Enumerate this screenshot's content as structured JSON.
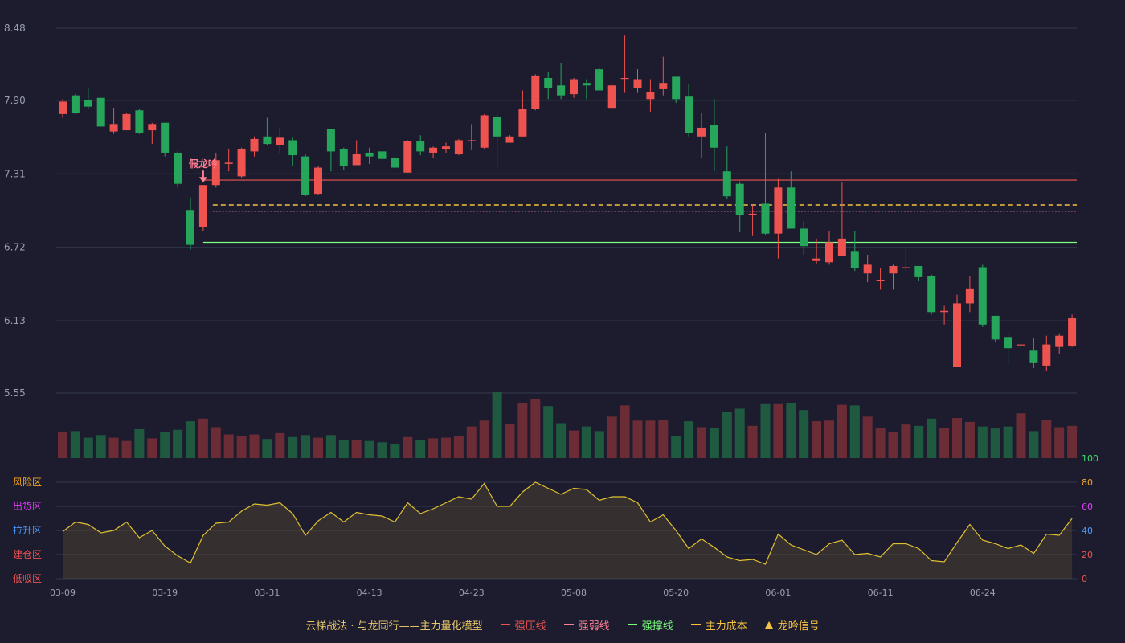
{
  "colors": {
    "up": "#ef5350",
    "down": "#26a65b",
    "grid": "#343a4e",
    "strong_pressure": "#ef5350",
    "strong_weak": "#ff7f94",
    "support": "#7cff7c",
    "cost": "#f5c242",
    "oscillator": "#e0c030"
  },
  "legend": {
    "title": "云梯战法 · 与龙同行——主力量化模型",
    "items": [
      {
        "label": "强压线",
        "color": "#ef5350",
        "style": "solid"
      },
      {
        "label": "强弱线",
        "color": "#ff7f94",
        "style": "dashed"
      },
      {
        "label": "强撑线",
        "color": "#7cff7c",
        "style": "solid"
      },
      {
        "label": "主力成本",
        "color": "#f5c242",
        "style": "dashed"
      },
      {
        "label": "龙吟信号",
        "color": "#f5c242",
        "style": "triangle"
      }
    ]
  },
  "chart_data": {
    "type": "candlestick",
    "price_axis": {
      "ticks": [
        "8.48",
        "7.90",
        "7.31",
        "6.72",
        "6.13",
        "5.55"
      ],
      "ylim": [
        5.55,
        8.48
      ]
    },
    "x_ticks": [
      {
        "index": 0,
        "label": "03-09"
      },
      {
        "index": 8,
        "label": "03-19"
      },
      {
        "index": 16,
        "label": "03-31"
      },
      {
        "index": 24,
        "label": "04-13"
      },
      {
        "index": 32,
        "label": "04-23"
      },
      {
        "index": 40,
        "label": "05-08"
      },
      {
        "index": 48,
        "label": "05-20"
      },
      {
        "index": 56,
        "label": "06-01"
      },
      {
        "index": 64,
        "label": "06-11"
      },
      {
        "index": 72,
        "label": "06-24"
      }
    ],
    "candles": [
      [
        7.79,
        7.89,
        7.76,
        7.91
      ],
      [
        7.94,
        7.8,
        7.79,
        7.95
      ],
      [
        7.9,
        7.85,
        7.83,
        8.0
      ],
      [
        7.92,
        7.69,
        7.69,
        7.92
      ],
      [
        7.65,
        7.71,
        7.63,
        7.84
      ],
      [
        7.66,
        7.79,
        7.66,
        7.8
      ],
      [
        7.82,
        7.64,
        7.63,
        7.83
      ],
      [
        7.66,
        7.71,
        7.55,
        7.72
      ],
      [
        7.72,
        7.48,
        7.45,
        7.72
      ],
      [
        7.48,
        7.23,
        7.2,
        7.49
      ],
      [
        7.02,
        6.74,
        6.7,
        7.12
      ],
      [
        6.88,
        7.22,
        6.85,
        7.22
      ],
      [
        7.22,
        7.42,
        7.2,
        7.48
      ],
      [
        7.39,
        7.4,
        7.33,
        7.51
      ],
      [
        7.29,
        7.51,
        7.28,
        7.52
      ],
      [
        7.49,
        7.59,
        7.45,
        7.61
      ],
      [
        7.61,
        7.55,
        7.54,
        7.76
      ],
      [
        7.54,
        7.6,
        7.48,
        7.68
      ],
      [
        7.58,
        7.46,
        7.37,
        7.6
      ],
      [
        7.45,
        7.14,
        7.13,
        7.47
      ],
      [
        7.15,
        7.36,
        7.14,
        7.37
      ],
      [
        7.67,
        7.49,
        7.33,
        7.67
      ],
      [
        7.51,
        7.37,
        7.34,
        7.52
      ],
      [
        7.38,
        7.47,
        7.38,
        7.58
      ],
      [
        7.48,
        7.45,
        7.39,
        7.52
      ],
      [
        7.49,
        7.43,
        7.36,
        7.53
      ],
      [
        7.44,
        7.36,
        7.35,
        7.46
      ],
      [
        7.32,
        7.57,
        7.32,
        7.58
      ],
      [
        7.57,
        7.49,
        7.46,
        7.62
      ],
      [
        7.48,
        7.52,
        7.44,
        7.53
      ],
      [
        7.51,
        7.53,
        7.48,
        7.56
      ],
      [
        7.47,
        7.58,
        7.46,
        7.59
      ],
      [
        7.58,
        7.58,
        7.5,
        7.71
      ],
      [
        7.52,
        7.78,
        7.51,
        7.79
      ],
      [
        7.77,
        7.61,
        7.36,
        7.8
      ],
      [
        7.56,
        7.61,
        7.56,
        7.62
      ],
      [
        7.61,
        7.83,
        7.61,
        7.98
      ],
      [
        7.83,
        8.1,
        7.82,
        8.11
      ],
      [
        8.08,
        8.0,
        7.91,
        8.13
      ],
      [
        8.02,
        7.94,
        7.91,
        8.2
      ],
      [
        7.95,
        8.07,
        7.92,
        8.08
      ],
      [
        8.04,
        8.02,
        7.91,
        8.07
      ],
      [
        8.15,
        7.98,
        7.98,
        8.16
      ],
      [
        7.84,
        8.02,
        7.83,
        8.04
      ],
      [
        8.08,
        8.08,
        7.96,
        8.42
      ],
      [
        8.0,
        8.07,
        7.96,
        8.15
      ],
      [
        7.91,
        7.97,
        7.81,
        8.07
      ],
      [
        7.99,
        8.04,
        7.94,
        8.25
      ],
      [
        8.09,
        7.91,
        7.88,
        8.09
      ],
      [
        7.93,
        7.64,
        7.61,
        8.03
      ],
      [
        7.61,
        7.68,
        7.44,
        7.8
      ],
      [
        7.7,
        7.52,
        7.33,
        7.91
      ],
      [
        7.33,
        7.13,
        7.11,
        7.53
      ],
      [
        7.23,
        6.98,
        6.84,
        7.25
      ],
      [
        6.99,
        6.99,
        6.81,
        7.06
      ],
      [
        7.07,
        6.83,
        6.82,
        7.64
      ],
      [
        6.83,
        7.2,
        6.63,
        7.27
      ],
      [
        7.2,
        6.87,
        6.87,
        7.33
      ],
      [
        6.87,
        6.73,
        6.66,
        6.93
      ],
      [
        6.61,
        6.63,
        6.59,
        6.79
      ],
      [
        6.6,
        6.76,
        6.58,
        6.85
      ],
      [
        6.65,
        6.79,
        6.65,
        7.24
      ],
      [
        6.69,
        6.55,
        6.53,
        6.85
      ],
      [
        6.51,
        6.58,
        6.44,
        6.66
      ],
      [
        6.46,
        6.46,
        6.38,
        6.55
      ],
      [
        6.51,
        6.57,
        6.38,
        6.58
      ],
      [
        6.56,
        6.56,
        6.51,
        6.71
      ],
      [
        6.57,
        6.48,
        6.45,
        6.57
      ],
      [
        6.49,
        6.2,
        6.18,
        6.5
      ],
      [
        6.2,
        6.21,
        6.1,
        6.25
      ],
      [
        5.76,
        6.27,
        5.76,
        6.34
      ],
      [
        6.27,
        6.39,
        6.2,
        6.49
      ],
      [
        6.56,
        6.1,
        6.08,
        6.58
      ],
      [
        6.17,
        5.98,
        5.96,
        6.17
      ],
      [
        6.0,
        5.91,
        5.78,
        6.03
      ],
      [
        5.94,
        5.94,
        5.64,
        5.99
      ],
      [
        5.89,
        5.79,
        5.75,
        5.99
      ],
      [
        5.77,
        5.94,
        5.73,
        6.01
      ],
      [
        5.92,
        6.01,
        5.86,
        6.03
      ],
      [
        5.93,
        6.15,
        5.92,
        6.18
      ]
    ],
    "volume": [
      0.4,
      0.41,
      0.31,
      0.35,
      0.31,
      0.26,
      0.44,
      0.3,
      0.39,
      0.43,
      0.56,
      0.6,
      0.47,
      0.36,
      0.33,
      0.36,
      0.29,
      0.38,
      0.32,
      0.35,
      0.31,
      0.35,
      0.27,
      0.28,
      0.26,
      0.24,
      0.22,
      0.32,
      0.27,
      0.3,
      0.31,
      0.34,
      0.48,
      0.57,
      1.0,
      0.52,
      0.83,
      0.89,
      0.79,
      0.53,
      0.42,
      0.48,
      0.41,
      0.63,
      0.8,
      0.57,
      0.57,
      0.58,
      0.33,
      0.56,
      0.47,
      0.46,
      0.7,
      0.75,
      0.49,
      0.82,
      0.82,
      0.84,
      0.73,
      0.56,
      0.57,
      0.81,
      0.8,
      0.63,
      0.46,
      0.4,
      0.51,
      0.49,
      0.6,
      0.46,
      0.61,
      0.55,
      0.48,
      0.45,
      0.48,
      0.68,
      0.41,
      0.58,
      0.47,
      0.49
    ],
    "levels": {
      "strong_pressure": 7.26,
      "main_cost": 7.06,
      "strong_weak": 7.01,
      "strong_support": 6.76
    },
    "signal": {
      "index": 11,
      "label": "假龙吟"
    },
    "oscillator": {
      "axis_ticks": [
        "100",
        "80",
        "60",
        "40",
        "20",
        "0"
      ],
      "zones": [
        "风险区",
        "出货区",
        "拉升区",
        "建仓区",
        "低吸区"
      ],
      "values": [
        39,
        47,
        45,
        38,
        40,
        47,
        34,
        40,
        27,
        19,
        13,
        36,
        46,
        47,
        56,
        62,
        61,
        63,
        54,
        36,
        48,
        55,
        47,
        55,
        53,
        52,
        47,
        63,
        54,
        58,
        63,
        68,
        66,
        79,
        60,
        60,
        72,
        80,
        75,
        70,
        75,
        74,
        65,
        68,
        68,
        63,
        47,
        53,
        40,
        25,
        33,
        26,
        18,
        15,
        16,
        12,
        37,
        28,
        24,
        20,
        29,
        32,
        20,
        21,
        18,
        29,
        29,
        25,
        15,
        14,
        30,
        45,
        32,
        29,
        25,
        28,
        21,
        37,
        36,
        50
      ]
    }
  }
}
